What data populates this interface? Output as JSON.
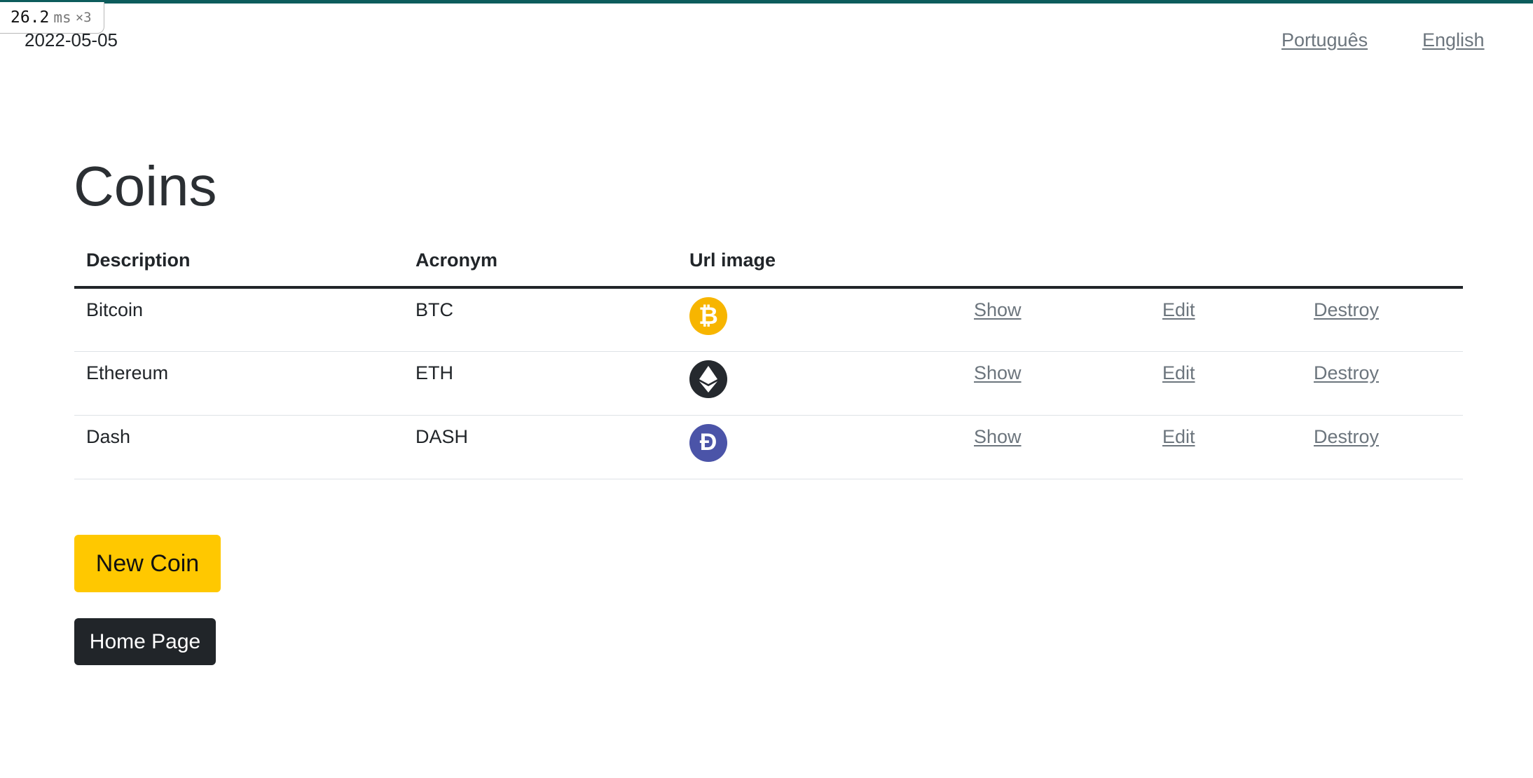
{
  "perf": {
    "value": "26.2",
    "unit": "ms",
    "multiplier": "×3"
  },
  "header": {
    "date": "2022-05-05",
    "languages": [
      "Português",
      "English"
    ]
  },
  "page": {
    "title": "Coins"
  },
  "table": {
    "columns": [
      "Description",
      "Acronym",
      "Url image"
    ],
    "rows": [
      {
        "description": "Bitcoin",
        "acronym": "BTC",
        "icon": "bitcoin-icon",
        "color": "#F7B500",
        "symbol": "₿",
        "show": "Show",
        "edit": "Edit",
        "destroy": "Destroy"
      },
      {
        "description": "Ethereum",
        "acronym": "ETH",
        "icon": "ethereum-icon",
        "color": "#25292E",
        "symbol": "◆",
        "show": "Show",
        "edit": "Edit",
        "destroy": "Destroy"
      },
      {
        "description": "Dash",
        "acronym": "DASH",
        "icon": "dash-icon",
        "color": "#4B54A8",
        "symbol": "Đ",
        "show": "Show",
        "edit": "Edit",
        "destroy": "Destroy"
      }
    ]
  },
  "buttons": {
    "new_coin": "New Coin",
    "home_page": "Home Page"
  },
  "colors": {
    "top_strip": "#0D5C5C",
    "new_button": "#FFC800",
    "home_button": "#212529",
    "link": "#6C757D"
  }
}
